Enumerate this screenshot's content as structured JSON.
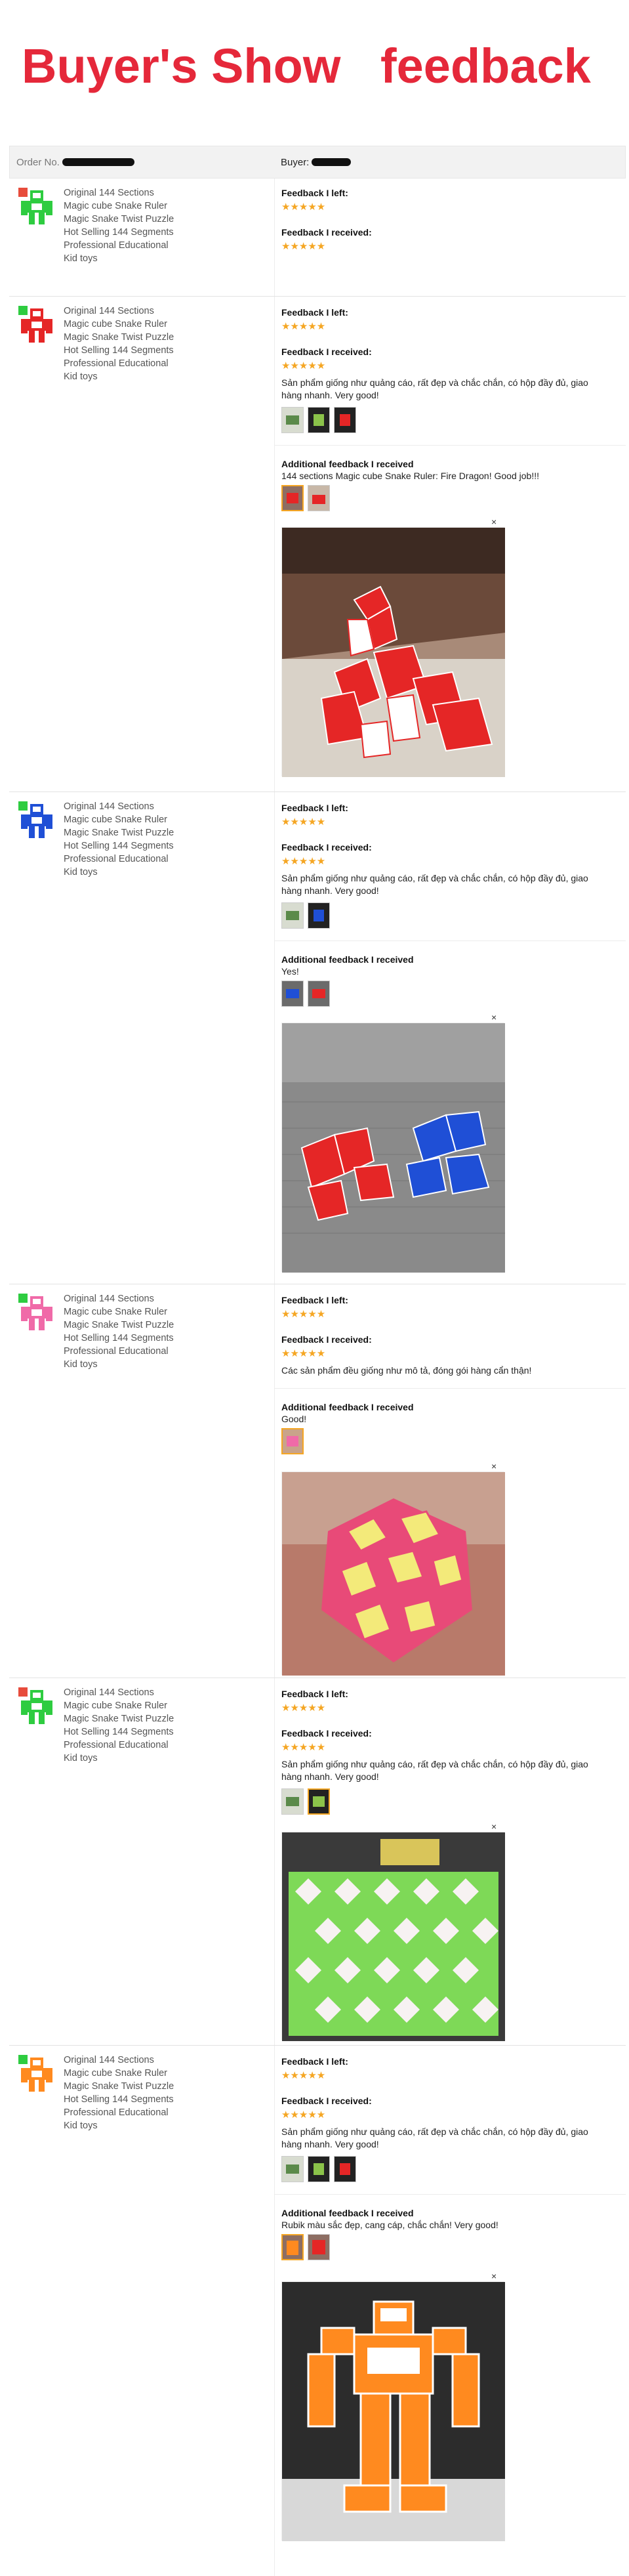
{
  "hero": {
    "left": "Buyer's Show",
    "right": "feedback"
  },
  "header": {
    "order_label": "Order No.",
    "buyer_label": "Buyer:"
  },
  "product_lines": [
    "Original 144 Sections",
    "Magic cube Snake Ruler",
    "Magic Snake Twist Puzzle",
    "Hot Selling 144 Segments",
    "Professional Educational",
    "Kid toys"
  ],
  "labels": {
    "left": "Feedback I left:",
    "received": "Feedback I received:",
    "additional": "Additional feedback I received",
    "stars": "★★★★★",
    "close": "×"
  },
  "orders": [
    {
      "variant": "green",
      "comment": "",
      "additional": ""
    },
    {
      "variant": "red",
      "comment": "Sản phẩm giống như quảng cáo, rất đẹp và chắc chắn, có hộp đầy đủ, giao hàng nhanh. Very good!",
      "additional": "144 sections Magic cube Snake Ruler: Fire Dragon! Good job!!!"
    },
    {
      "variant": "blue",
      "comment": "Sản phẩm giống như quảng cáo, rất đẹp và chắc chắn, có hộp đầy đủ, giao hàng nhanh. Very good!",
      "additional": "Yes!"
    },
    {
      "variant": "pink",
      "comment": "Các sản phẩm đều giống như mô tả, đóng gói hàng cẩn thận!",
      "additional": "Good!"
    },
    {
      "variant": "green",
      "comment": "Sản phẩm giống như quảng cáo, rất đẹp và chắc chắn, có hộp đầy đủ, giao hàng nhanh. Very good!",
      "additional": ""
    },
    {
      "variant": "orange",
      "comment": "Sản phẩm giống như quảng cáo, rất đẹp và chắc chắn, có hộp đầy đủ, giao hàng nhanh. Very good!",
      "additional": "Rubik màu sắc đẹp, cang cáp, chắc chắn! Very good!"
    }
  ],
  "colors": {
    "brand_red": "#e5283a",
    "star": "#f5a623"
  }
}
